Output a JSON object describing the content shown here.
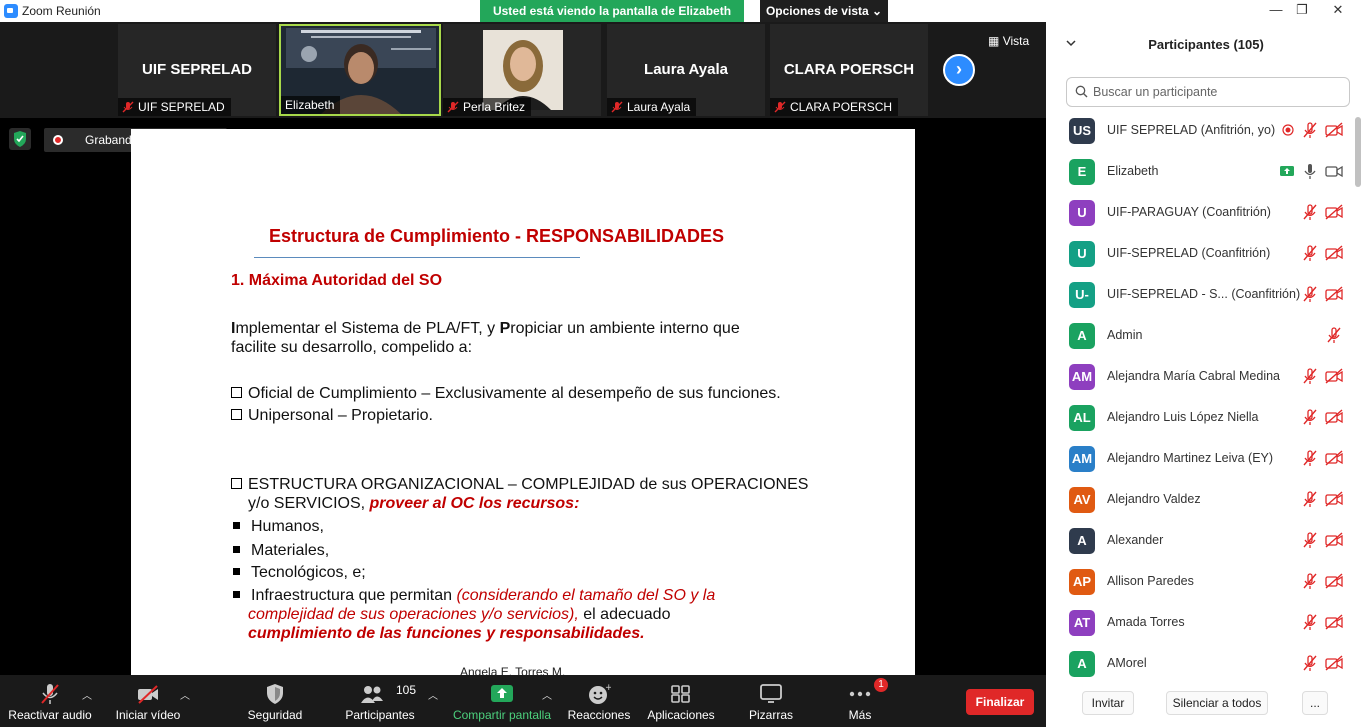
{
  "window": {
    "title": "Zoom Reunión",
    "share_banner": "Usted está viendo la pantalla de Elizabeth",
    "view_options": "Opciones de vista"
  },
  "videos": {
    "tiles": [
      {
        "big_name": "UIF SEPRELAD",
        "label": "UIF SEPRELAD",
        "muted": true,
        "has_video": false
      },
      {
        "big_name": "",
        "label": "Elizabeth",
        "muted": false,
        "has_video": true,
        "active": true
      },
      {
        "big_name": "",
        "label": "Perla Britez",
        "muted": true,
        "has_video": true
      },
      {
        "big_name": "Laura Ayala",
        "label": "Laura Ayala",
        "muted": true,
        "has_video": false
      },
      {
        "big_name": "CLARA POERSCH",
        "label": "CLARA POERSCH",
        "muted": true,
        "has_video": false
      }
    ],
    "view_label": "Vista"
  },
  "recording": {
    "label": "Grabando..."
  },
  "slide": {
    "title": "Estructura de Cumplimiento - RESPONSABILIDADES",
    "heading": "1. Máxima Autoridad del SO",
    "para_1_I": "I",
    "para_1_a": "mplementar el Sistema de PLA/FT, y ",
    "para_1_P": "P",
    "para_1_b": "ropiciar un ambiente interno que",
    "para_1_line2": "facilite su desarrollo, compelido a:",
    "check_1": "Oficial de Cumplimiento – Exclusivamente al desempeño de sus funciones.",
    "check_2": "Unipersonal – Propietario.",
    "check_3_line1": "ESTRUCTURA ORGANIZACIONAL – COMPLEJIDAD de sus OPERACIONES",
    "check_3_line2_a": "y/o SERVICIOS, ",
    "check_3_line2_b": "proveer al OC los recursos:",
    "bullet_1": "Humanos,",
    "bullet_2": "Materiales,",
    "bullet_3": "Tecnológicos, e;",
    "bullet_4_a": "Infraestructura que permitan ",
    "bullet_4_b": "(considerando el tamaño del SO y la",
    "bullet_4_c": "complejidad de sus operaciones y/o servicios),",
    "bullet_4_d": " el adecuado",
    "bullet_4_e": "cumplimiento de las funciones y responsabilidades.",
    "footer": "Angela E. Torres M."
  },
  "toolbar": {
    "audio": "Reactivar audio",
    "video": "Iniciar vídeo",
    "security": "Seguridad",
    "participants": "Participantes",
    "participants_count": "105",
    "share": "Compartir pantalla",
    "reactions": "Reacciones",
    "apps": "Aplicaciones",
    "whiteboards": "Pizarras",
    "more": "Más",
    "more_badge": "1",
    "end": "Finalizar"
  },
  "panel": {
    "title": "Participantes (105)",
    "search_placeholder": "Buscar un participante",
    "participants": [
      {
        "initials": "US",
        "name": "UIF SEPRELAD (Anfitrión, yo)",
        "color": "#2f3b4d",
        "mic": "muted",
        "cam": "off",
        "rec": true
      },
      {
        "initials": "E",
        "name": "Elizabeth",
        "color": "#1aa260",
        "mic": "on",
        "cam": "on",
        "sharing": true
      },
      {
        "initials": "U",
        "name": "UIF-PARAGUAY (Coanfitrión)",
        "color": "#8e3fbf",
        "mic": "muted",
        "cam": "off"
      },
      {
        "initials": "U",
        "name": "UIF-SEPRELAD (Coanfitrión)",
        "color": "#14a085",
        "mic": "muted",
        "cam": "off"
      },
      {
        "initials": "U-",
        "name": "UIF-SEPRELAD - S...  (Coanfitrión)",
        "color": "#14a085",
        "mic": "muted",
        "cam": "off"
      },
      {
        "initials": "A",
        "name": "Admin",
        "color": "#1aa260",
        "mic": "muted",
        "cam": "none"
      },
      {
        "initials": "AM",
        "name": "Alejandra María Cabral Medina",
        "color": "#8e3fbf",
        "mic": "muted",
        "cam": "off"
      },
      {
        "initials": "AL",
        "name": "Alejandro Luis López Niella",
        "color": "#1aa260",
        "mic": "muted",
        "cam": "off"
      },
      {
        "initials": "AM",
        "name": "Alejandro Martinez Leiva (EY)",
        "color": "#2a7fc8",
        "mic": "muted",
        "cam": "off"
      },
      {
        "initials": "AV",
        "name": "Alejandro Valdez",
        "color": "#e05a12",
        "mic": "muted",
        "cam": "off"
      },
      {
        "initials": "A",
        "name": "Alexander",
        "color": "#2f3b4d",
        "mic": "muted",
        "cam": "off"
      },
      {
        "initials": "AP",
        "name": "Allison Paredes",
        "color": "#e05a12",
        "mic": "muted",
        "cam": "off"
      },
      {
        "initials": "AT",
        "name": "Amada Torres",
        "color": "#8e3fbf",
        "mic": "muted",
        "cam": "off"
      },
      {
        "initials": "A",
        "name": "AMorel",
        "color": "#1aa260",
        "mic": "muted",
        "cam": "off"
      }
    ],
    "invite": "Invitar",
    "mute_all": "Silenciar a todos",
    "more": "..."
  }
}
